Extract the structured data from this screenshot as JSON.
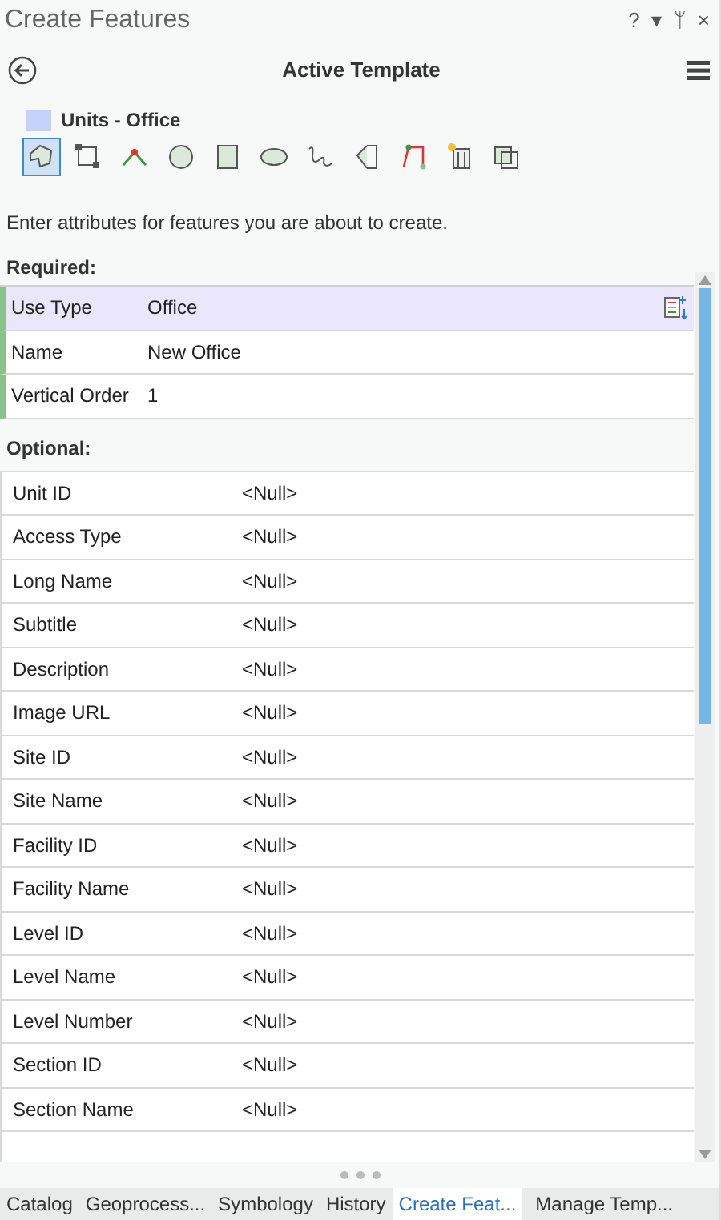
{
  "window": {
    "title": "Create Features",
    "controls": [
      "?",
      "▾",
      "ᛘ",
      "×"
    ]
  },
  "header": {
    "title": "Active Template"
  },
  "template": {
    "name": "Units - Office",
    "color": "#c4d2fb"
  },
  "tools": [
    {
      "kind": "polygon",
      "selected": true
    },
    {
      "kind": "rectangle-vertices",
      "selected": false
    },
    {
      "kind": "vertex",
      "selected": false
    },
    {
      "kind": "circle",
      "selected": false
    },
    {
      "kind": "rectangle",
      "selected": false
    },
    {
      "kind": "ellipse",
      "selected": false
    },
    {
      "kind": "freehand",
      "selected": false
    },
    {
      "kind": "split",
      "selected": false
    },
    {
      "kind": "trace",
      "selected": false
    },
    {
      "kind": "building",
      "selected": false
    },
    {
      "kind": "copy",
      "selected": false
    }
  ],
  "instructions": "Enter attributes for features you are about to create.",
  "required": {
    "label": "Required:",
    "rows": [
      {
        "name": "Use Type",
        "value": "Office",
        "selected": true
      },
      {
        "name": "Name",
        "value": "New Office",
        "selected": false
      },
      {
        "name": "Vertical Order",
        "value": "1",
        "selected": false
      }
    ]
  },
  "optional": {
    "label": "Optional:",
    "rows": [
      {
        "name": "Unit ID",
        "value": "<Null>"
      },
      {
        "name": "Access Type",
        "value": "<Null>"
      },
      {
        "name": "Long Name",
        "value": "<Null>"
      },
      {
        "name": "Subtitle",
        "value": "<Null>"
      },
      {
        "name": "Description",
        "value": "<Null>"
      },
      {
        "name": "Image URL",
        "value": "<Null>"
      },
      {
        "name": "Site ID",
        "value": "<Null>"
      },
      {
        "name": "Site Name",
        "value": "<Null>"
      },
      {
        "name": "Facility ID",
        "value": "<Null>"
      },
      {
        "name": "Facility Name",
        "value": "<Null>"
      },
      {
        "name": "Level ID",
        "value": "<Null>"
      },
      {
        "name": "Level Name",
        "value": "<Null>"
      },
      {
        "name": "Level Number",
        "value": "<Null>"
      },
      {
        "name": "Section ID",
        "value": "<Null>"
      },
      {
        "name": "Section Name",
        "value": "<Null>"
      }
    ]
  },
  "bottom_tabs": [
    {
      "label": "Catalog",
      "selected": false
    },
    {
      "label": "Geoprocess...",
      "selected": false
    },
    {
      "label": "Symbology",
      "selected": false
    },
    {
      "label": "History",
      "selected": false
    },
    {
      "label": "Create Feat...",
      "selected": true
    },
    {
      "label": "Manage Temp...",
      "selected": false
    }
  ]
}
